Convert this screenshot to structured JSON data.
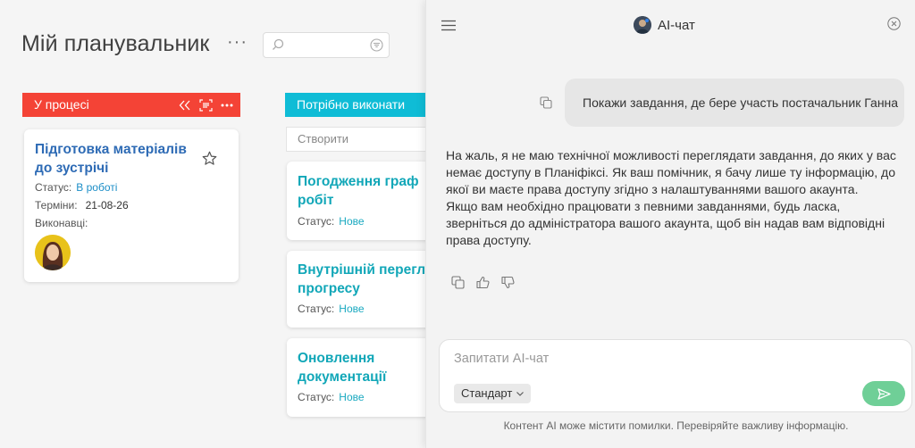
{
  "board": {
    "title": "Мій планувальник",
    "more": "···"
  },
  "columns": [
    {
      "name": "У процесі",
      "color": "#f44336",
      "cards": [
        {
          "title_line1": "Підготовка матеріалів",
          "title_line2": "до зустрічі",
          "status_label": "Статус:",
          "status_value": "В роботі",
          "dates_label": "Терміни:",
          "dates_value": "21-08-26",
          "assignees_label": "Виконавці:"
        }
      ]
    },
    {
      "name": "Потрібно виконати",
      "color": "#0fbcd6",
      "create_label": "Створити",
      "cards": [
        {
          "title_line1": "Погодження граф",
          "title_line2": "робіт",
          "status_label": "Статус:",
          "status_value": "Нове"
        },
        {
          "title_line1": "Внутрішній перегл",
          "title_line2": "прогресу",
          "status_label": "Статус:",
          "status_value": "Нове"
        },
        {
          "title_line1": "Оновлення",
          "title_line2": "документації",
          "status_label": "Статус:",
          "status_value": "Нове"
        }
      ]
    }
  ],
  "chat": {
    "title": "AI-чат",
    "user_message": "Покажи завдання, де бере участь постачальник Ганна",
    "ai_paragraph1": "На жаль, я не маю технічної можливості переглядати завдання, до яких у вас немає доступу в Планіфіксі. Як ваш помічник, я бачу лише ту інформацію, до якої ви маєте права доступу згідно з налаштуваннями вашого акаунта.",
    "ai_paragraph2": "Якщо вам необхідно працювати з певними завданнями, будь ласка, зверніться до адміністратора вашого акаунта, щоб він надав вам відповідні права доступу.",
    "input_placeholder": "Запитати AI-чат",
    "mode_label": "Стандарт",
    "disclaimer": "Контент AI може містити помилки. Перевіряйте важливу інформацію.",
    "send_color": "#6fcf97"
  }
}
